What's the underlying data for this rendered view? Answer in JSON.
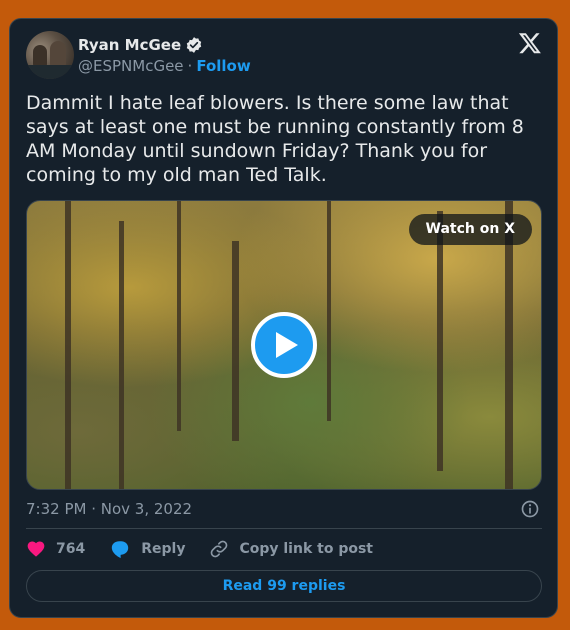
{
  "author": {
    "name": "Ryan McGee",
    "handle": "@ESPNMcGee",
    "separator": "·",
    "follow_label": "Follow",
    "verified": true
  },
  "tweet": {
    "text": "Dammit I hate leaf blowers. Is there some law that says at least one must be running constantly from 8 AM Monday until sundown Friday? Thank you for coming to my old man Ted Talk.",
    "timestamp": "7:32 PM · Nov 3, 2022"
  },
  "media": {
    "watch_label": "Watch on X",
    "play_icon": "play-icon"
  },
  "actions": {
    "likes_count": "764",
    "reply_label": "Reply",
    "copy_label": "Copy link to post"
  },
  "footer": {
    "read_replies_label": "Read 99 replies"
  },
  "colors": {
    "background": "#c35a0b",
    "card": "#15202b",
    "accent": "#1d9bf0",
    "like": "#f91880",
    "muted": "#8b98a5"
  }
}
